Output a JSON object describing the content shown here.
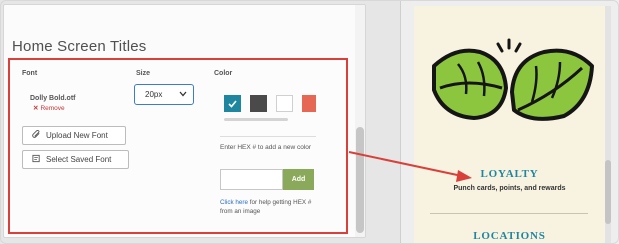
{
  "section": {
    "title": "Home Screen Titles"
  },
  "font": {
    "label": "Font",
    "current": "Dolly Bold.otf",
    "remove": "Remove",
    "upload_button": "Upload New Font",
    "select_button": "Select Saved Font"
  },
  "size": {
    "label": "Size",
    "value": "20px"
  },
  "color": {
    "label": "Color",
    "swatches": [
      "#1f86a0",
      "#4a4a4a",
      "#ffffff",
      "#e76755"
    ],
    "selected_index": 0,
    "hex_help": "Enter HEX # to add a new color",
    "hex_placeholder": "",
    "add_button": "Add",
    "help_link": "Click here",
    "help_rest": " for help getting HEX # from an image"
  },
  "preview": {
    "items": [
      {
        "title": "LOYALTY",
        "subtitle": "Punch cards, points, and rewards"
      },
      {
        "title": "LOCATIONS"
      }
    ],
    "title_color": "#1f86a0",
    "background": "#f8f3e1"
  },
  "accent": {
    "highlight": "#d9403a",
    "add_button": "#8aa95a",
    "leaf_green": "#8cc63f"
  }
}
